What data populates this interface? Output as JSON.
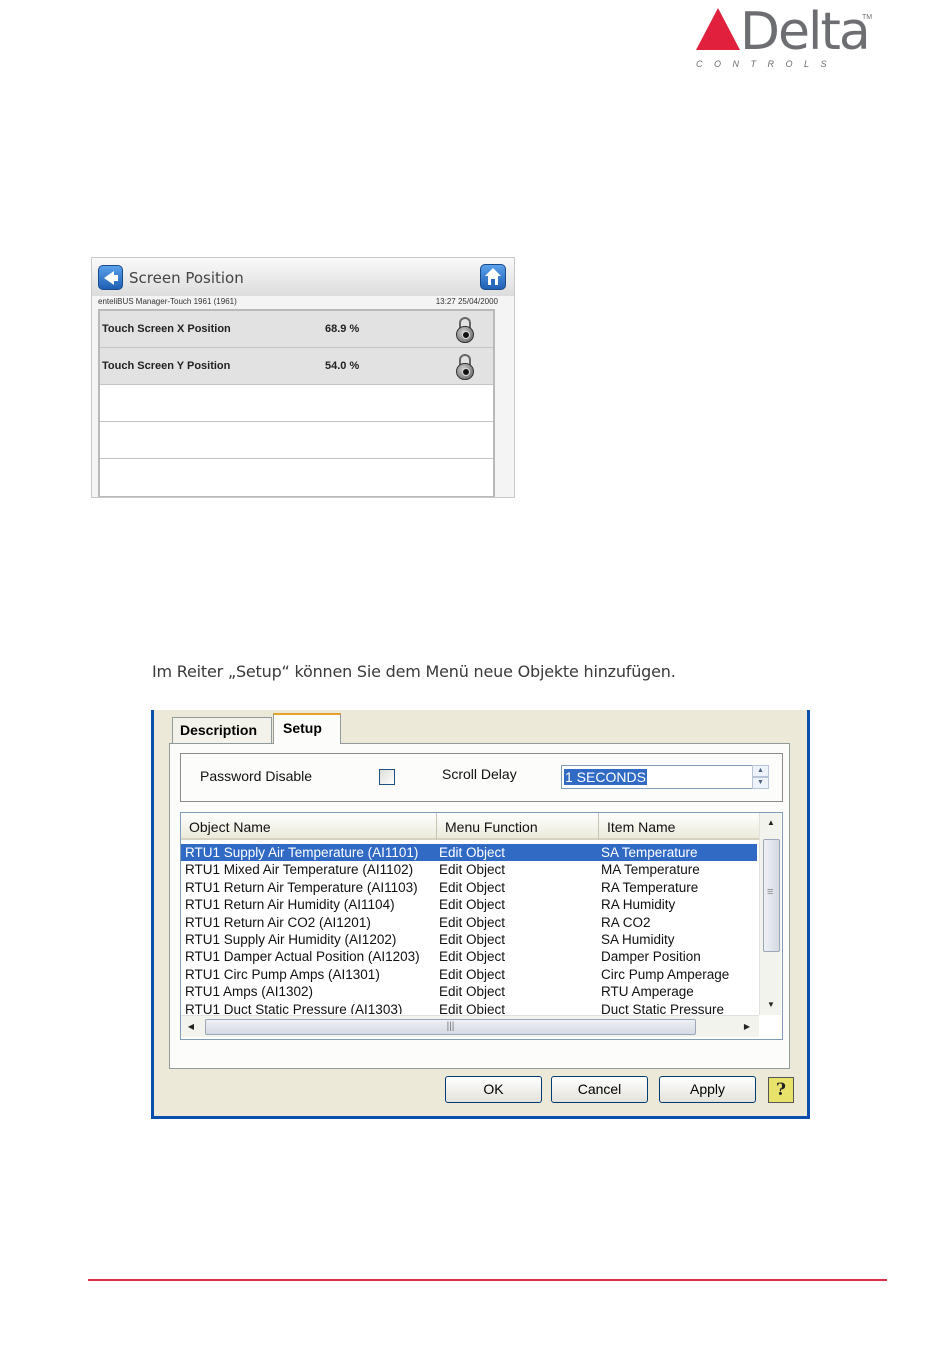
{
  "logo": {
    "word": "Delta",
    "subtitle": "CONTROLS",
    "tm": "TM",
    "brand_color": "#e0203c"
  },
  "touch_screen": {
    "title": "Screen Position",
    "device_info": "enteliBUS Manager-Touch 1961 (1961)",
    "timestamp": "13:27 25/04/2000",
    "rows": [
      {
        "label": "Touch Screen X Position",
        "value": "68.9 %",
        "icon": "padlock-icon"
      },
      {
        "label": "Touch Screen Y Position",
        "value": "54.0 %",
        "icon": "padlock-icon"
      }
    ]
  },
  "paragraph": "Im Reiter „Setup“ können Sie dem Menü neue Objekte hinzufügen.",
  "dialog": {
    "tabs": [
      "Description",
      "Setup"
    ],
    "active_tab": "Setup",
    "password_disable_label": "Password Disable",
    "password_disable_checked": false,
    "scroll_delay_label": "Scroll Delay",
    "scroll_delay_value": "1 SECONDS",
    "columns": [
      "Object Name",
      "Menu Function",
      "Item Name"
    ],
    "rows": [
      [
        "RTU1 Supply Air Temperature (AI1101)",
        "Edit Object",
        "SA Temperature"
      ],
      [
        "RTU1 Mixed Air Temperature (AI1102)",
        "Edit Object",
        "MA Temperature"
      ],
      [
        "RTU1 Return Air Temperature (AI1103)",
        "Edit Object",
        "RA Temperature"
      ],
      [
        "RTU1 Return Air Humidity (AI1104)",
        "Edit Object",
        "RA Humidity"
      ],
      [
        "RTU1 Return Air CO2 (AI1201)",
        "Edit Object",
        "RA CO2"
      ],
      [
        "RTU1 Supply Air Humidity (AI1202)",
        "Edit Object",
        "SA Humidity"
      ],
      [
        "RTU1 Damper Actual Position (AI1203)",
        "Edit Object",
        "Damper Position"
      ],
      [
        "RTU1 Circ Pump Amps (AI1301)",
        "Edit Object",
        "Circ Pump Amperage"
      ],
      [
        "RTU1 Amps (AI1302)",
        "Edit Object",
        "RTU Amperage"
      ],
      [
        "RTU1 Duct Static Pressure (AI1303)",
        "Edit Object",
        "Duct Static Pressure"
      ]
    ],
    "selected_row": 0,
    "buttons": {
      "ok": "OK",
      "cancel": "Cancel",
      "apply": "Apply",
      "help": "?"
    },
    "selection_color": "#316ac5"
  },
  "footer": {
    "line_color": "#d9304a"
  }
}
